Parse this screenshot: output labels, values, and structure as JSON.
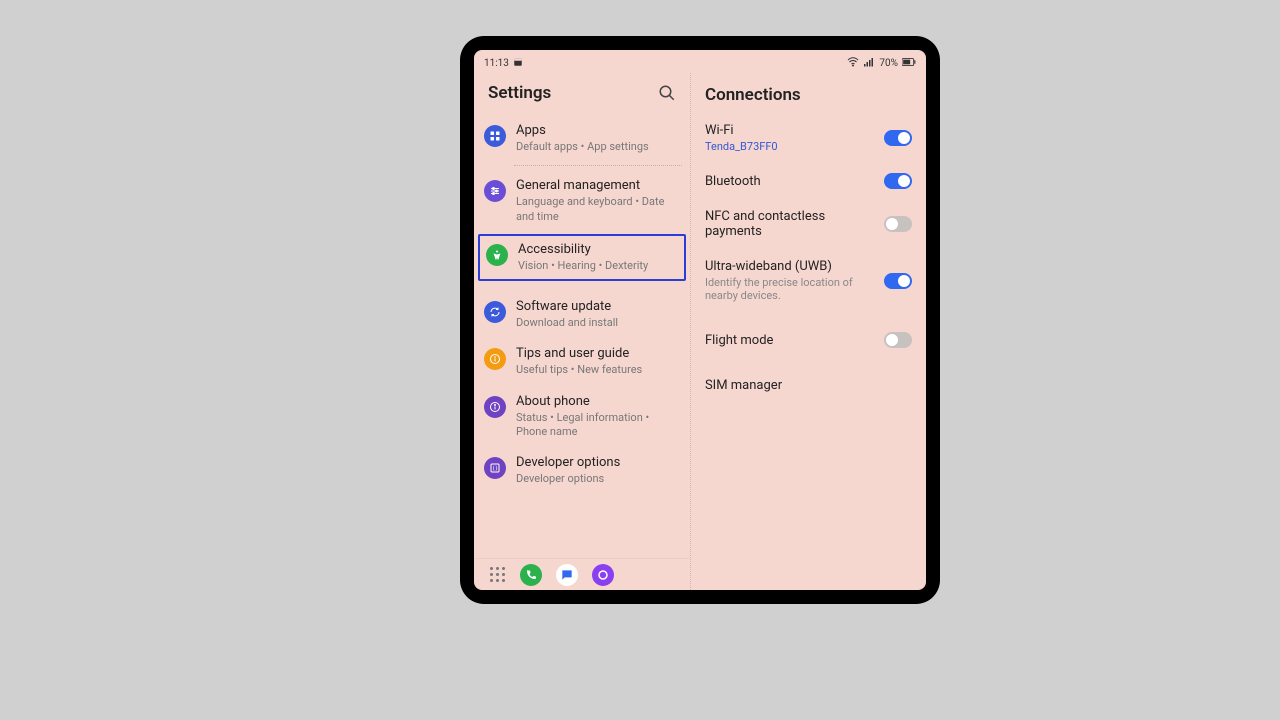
{
  "status": {
    "time": "11:13",
    "battery": "70%"
  },
  "leftPane": {
    "title": "Settings"
  },
  "items": [
    {
      "title": "Apps",
      "sub": "Default apps • App settings"
    },
    {
      "title": "General management",
      "sub": "Language and keyboard • Date and time"
    },
    {
      "title": "Accessibility",
      "sub": "Vision • Hearing • Dexterity"
    },
    {
      "title": "Software update",
      "sub": "Download and install"
    },
    {
      "title": "Tips and user guide",
      "sub": "Useful tips • New features"
    },
    {
      "title": "About phone",
      "sub": "Status • Legal information • Phone name"
    },
    {
      "title": "Developer options",
      "sub": "Developer options"
    }
  ],
  "rightPane": {
    "title": "Connections"
  },
  "connections": [
    {
      "title": "Wi-Fi",
      "sub": "Tenda_B73FF0",
      "subColor": "blue",
      "toggle": true
    },
    {
      "title": "Bluetooth",
      "sub": "",
      "toggle": true
    },
    {
      "title": "NFC and contactless payments",
      "sub": "",
      "toggle": false
    },
    {
      "title": "Ultra-wideband (UWB)",
      "sub": "Identify the precise location of nearby devices.",
      "subColor": "gray",
      "toggle": true
    },
    {
      "title": "Flight mode",
      "sub": "",
      "toggle": false
    },
    {
      "title": "SIM manager",
      "sub": "",
      "toggle": null
    }
  ]
}
